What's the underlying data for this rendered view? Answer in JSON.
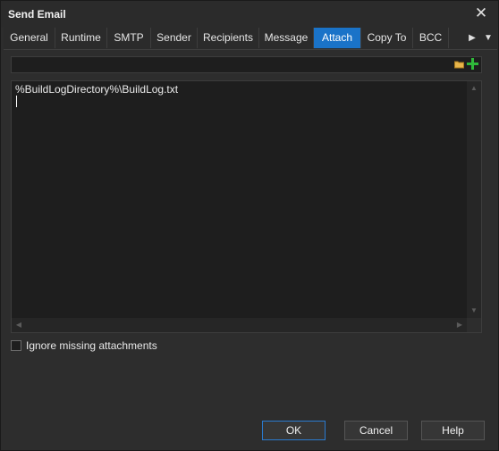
{
  "window": {
    "title": "Send Email",
    "close_glyph": "✕"
  },
  "tabs": [
    {
      "label": "General"
    },
    {
      "label": "Runtime"
    },
    {
      "label": "SMTP"
    },
    {
      "label": "Sender"
    },
    {
      "label": "Recipients"
    },
    {
      "label": "Message"
    },
    {
      "label": "Attach",
      "active": true
    },
    {
      "label": "Copy To"
    },
    {
      "label": "BCC"
    }
  ],
  "tab_scroll": {
    "next_glyph": "▶",
    "menu_glyph": "▼"
  },
  "attach": {
    "path_value": "",
    "browse_icon": "folder-icon",
    "add_icon": "plus-icon",
    "add_color": "#2fb83a",
    "list_text": "%BuildLogDirectory%\\BuildLog.txt"
  },
  "options": {
    "ignore_missing_label": "Ignore missing attachments",
    "ignore_missing_checked": false
  },
  "buttons": {
    "ok": "OK",
    "cancel": "Cancel",
    "help": "Help"
  },
  "colors": {
    "accent": "#1a73c8",
    "background": "#2d2d2d"
  }
}
